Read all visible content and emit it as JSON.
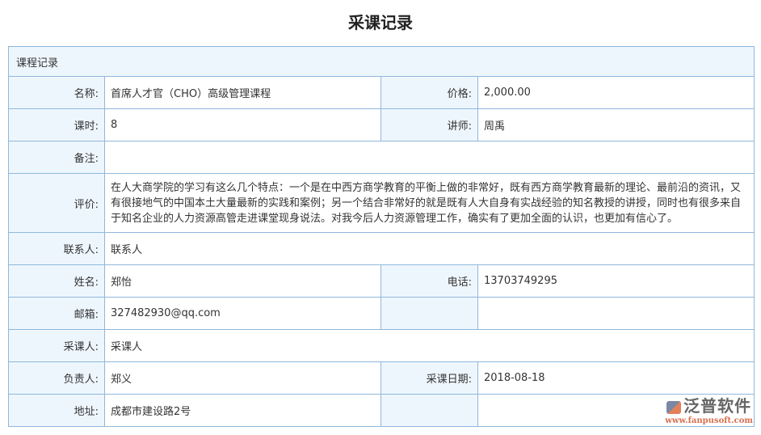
{
  "page_title": "采课记录",
  "section": "课程记录",
  "fields": {
    "name": {
      "label": "名称:",
      "value": "首席人才官（CHO）高级管理课程"
    },
    "price": {
      "label": "价格:",
      "value": "2,000.00"
    },
    "hours": {
      "label": "课时:",
      "value": "8"
    },
    "teacher": {
      "label": "讲师:",
      "value": "周禹"
    },
    "remark": {
      "label": "备注:",
      "value": ""
    },
    "review": {
      "label": "评价:",
      "value": "在人大商学院的学习有这么几个特点：一个是在中西方商学教育的平衡上做的非常好，既有西方商学教育最新的理论、最前沿的资讯，又有很接地气的中国本土大量最新的实践和案例；另一个结合非常好的就是既有人大自身有实战经验的知名教授的讲授，同时也有很多来自于知名企业的人力资源高管走进课堂现身说法。对我今后人力资源管理工作，确实有了更加全面的认识，也更加有信心了。"
    },
    "contact": {
      "label": "联系人:",
      "value": "联系人"
    },
    "person": {
      "label": "姓名:",
      "value": "郑怡"
    },
    "phone": {
      "label": "电话:",
      "value": "13703749295"
    },
    "email": {
      "label": "邮箱:",
      "value": "327482930@qq.com"
    },
    "buyer": {
      "label": "采课人:",
      "value": "采课人"
    },
    "owner": {
      "label": "负责人:",
      "value": "郑义"
    },
    "date": {
      "label": "采课日期:",
      "value": "2018-08-18"
    },
    "address": {
      "label": "地址:",
      "value": "成都市建设路2号"
    }
  },
  "logo": {
    "name": "泛普软件",
    "url": "www.fanpusoft.com"
  }
}
